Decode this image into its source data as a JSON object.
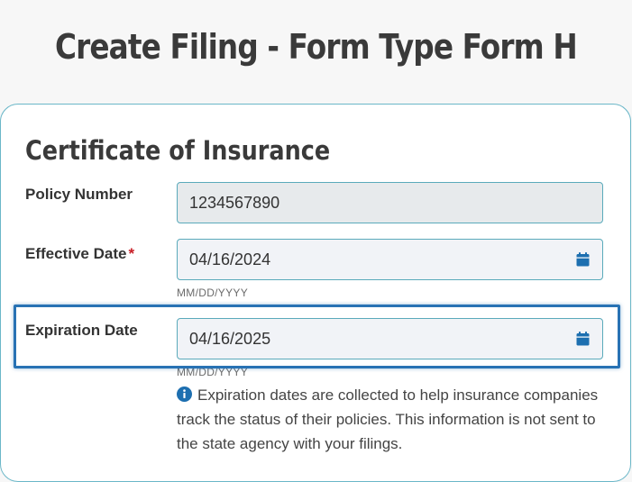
{
  "page": {
    "title": "Create Filing - Form Type Form H"
  },
  "section": {
    "title": "Certificate of Insurance"
  },
  "form": {
    "policy_number": {
      "label": "Policy Number",
      "value": "1234567890"
    },
    "effective_date": {
      "label": "Effective Date",
      "required_marker": "*",
      "value": "04/16/2024",
      "hint": "MM/DD/YYYY",
      "icon": "calendar-icon"
    },
    "expiration_date": {
      "label": "Expiration Date",
      "value": "04/16/2025",
      "hint": "MM/DD/YYYY",
      "icon": "calendar-icon",
      "info_icon": "info-circle-icon",
      "info_text": "Expiration dates are collected to help insurance companies track the status of their policies. This information is not sent to the state agency with your filings."
    }
  },
  "colors": {
    "field_border": "#5aaabb",
    "focus_outline": "#2872b4",
    "icon": "#1d6fb0",
    "required": "#c81d25"
  }
}
